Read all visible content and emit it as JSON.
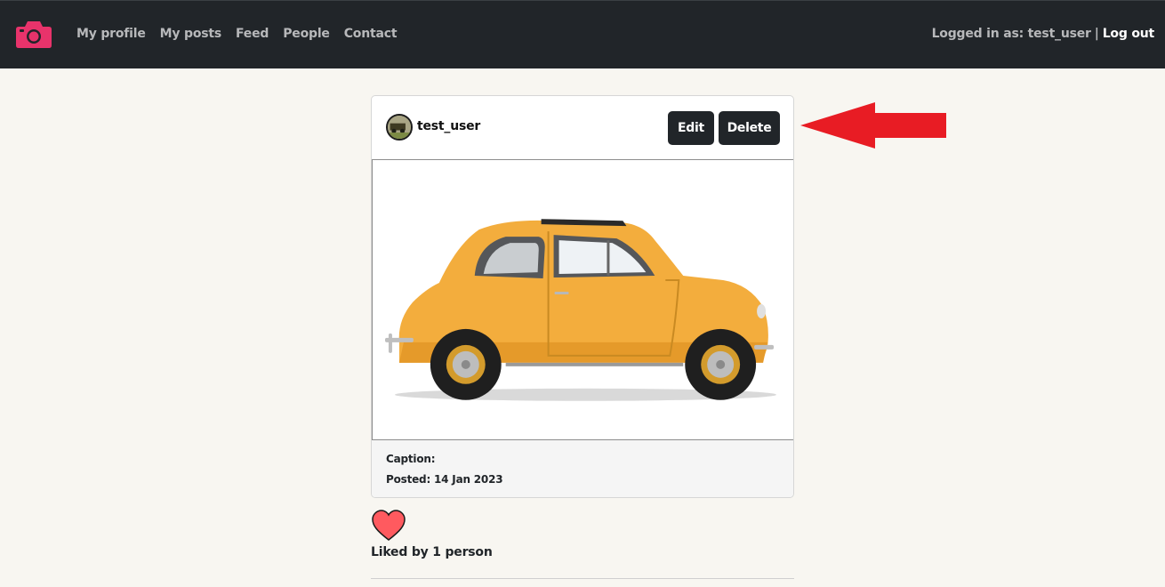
{
  "nav": {
    "links": [
      "My profile",
      "My posts",
      "Feed",
      "People",
      "Contact"
    ],
    "logged_in_label": "Logged in as: test_user",
    "separator": "|",
    "logout": "Log out"
  },
  "post": {
    "username": "test_user",
    "edit_label": "Edit",
    "delete_label": "Delete",
    "caption": "Caption:",
    "posted": "Posted: 14 Jan 2023",
    "liked_by": "Liked by 1 person"
  },
  "colors": {
    "navbar": "#212529",
    "logo": "#e8336b",
    "heart": "#ff5a5f",
    "annotation_arrow": "#e81c24",
    "car_body": "#f3ad3d"
  }
}
